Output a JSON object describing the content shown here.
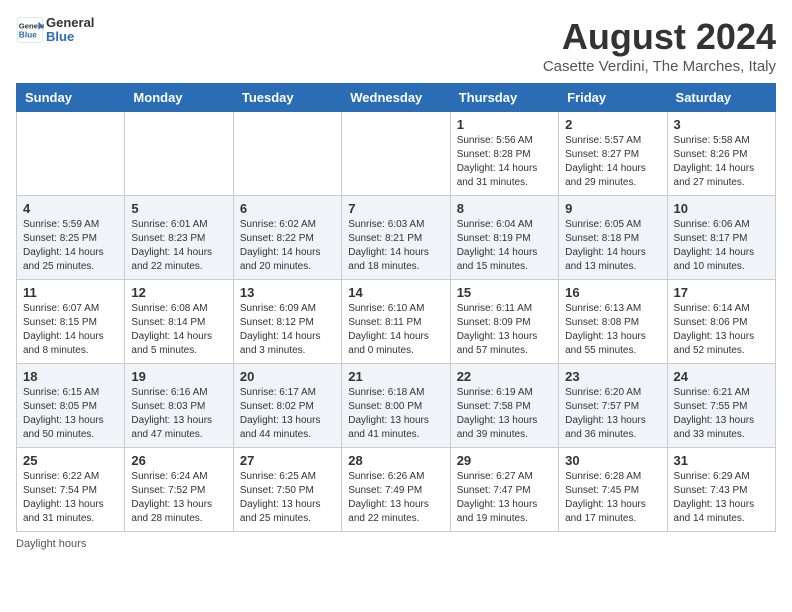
{
  "header": {
    "logo_general": "General",
    "logo_blue": "Blue",
    "month_year": "August 2024",
    "location": "Casette Verdini, The Marches, Italy"
  },
  "days_of_week": [
    "Sunday",
    "Monday",
    "Tuesday",
    "Wednesday",
    "Thursday",
    "Friday",
    "Saturday"
  ],
  "weeks": [
    [
      {
        "day": "",
        "info": ""
      },
      {
        "day": "",
        "info": ""
      },
      {
        "day": "",
        "info": ""
      },
      {
        "day": "",
        "info": ""
      },
      {
        "day": "1",
        "info": "Sunrise: 5:56 AM\nSunset: 8:28 PM\nDaylight: 14 hours\nand 31 minutes."
      },
      {
        "day": "2",
        "info": "Sunrise: 5:57 AM\nSunset: 8:27 PM\nDaylight: 14 hours\nand 29 minutes."
      },
      {
        "day": "3",
        "info": "Sunrise: 5:58 AM\nSunset: 8:26 PM\nDaylight: 14 hours\nand 27 minutes."
      }
    ],
    [
      {
        "day": "4",
        "info": "Sunrise: 5:59 AM\nSunset: 8:25 PM\nDaylight: 14 hours\nand 25 minutes."
      },
      {
        "day": "5",
        "info": "Sunrise: 6:01 AM\nSunset: 8:23 PM\nDaylight: 14 hours\nand 22 minutes."
      },
      {
        "day": "6",
        "info": "Sunrise: 6:02 AM\nSunset: 8:22 PM\nDaylight: 14 hours\nand 20 minutes."
      },
      {
        "day": "7",
        "info": "Sunrise: 6:03 AM\nSunset: 8:21 PM\nDaylight: 14 hours\nand 18 minutes."
      },
      {
        "day": "8",
        "info": "Sunrise: 6:04 AM\nSunset: 8:19 PM\nDaylight: 14 hours\nand 15 minutes."
      },
      {
        "day": "9",
        "info": "Sunrise: 6:05 AM\nSunset: 8:18 PM\nDaylight: 14 hours\nand 13 minutes."
      },
      {
        "day": "10",
        "info": "Sunrise: 6:06 AM\nSunset: 8:17 PM\nDaylight: 14 hours\nand 10 minutes."
      }
    ],
    [
      {
        "day": "11",
        "info": "Sunrise: 6:07 AM\nSunset: 8:15 PM\nDaylight: 14 hours\nand 8 minutes."
      },
      {
        "day": "12",
        "info": "Sunrise: 6:08 AM\nSunset: 8:14 PM\nDaylight: 14 hours\nand 5 minutes."
      },
      {
        "day": "13",
        "info": "Sunrise: 6:09 AM\nSunset: 8:12 PM\nDaylight: 14 hours\nand 3 minutes."
      },
      {
        "day": "14",
        "info": "Sunrise: 6:10 AM\nSunset: 8:11 PM\nDaylight: 14 hours\nand 0 minutes."
      },
      {
        "day": "15",
        "info": "Sunrise: 6:11 AM\nSunset: 8:09 PM\nDaylight: 13 hours\nand 57 minutes."
      },
      {
        "day": "16",
        "info": "Sunrise: 6:13 AM\nSunset: 8:08 PM\nDaylight: 13 hours\nand 55 minutes."
      },
      {
        "day": "17",
        "info": "Sunrise: 6:14 AM\nSunset: 8:06 PM\nDaylight: 13 hours\nand 52 minutes."
      }
    ],
    [
      {
        "day": "18",
        "info": "Sunrise: 6:15 AM\nSunset: 8:05 PM\nDaylight: 13 hours\nand 50 minutes."
      },
      {
        "day": "19",
        "info": "Sunrise: 6:16 AM\nSunset: 8:03 PM\nDaylight: 13 hours\nand 47 minutes."
      },
      {
        "day": "20",
        "info": "Sunrise: 6:17 AM\nSunset: 8:02 PM\nDaylight: 13 hours\nand 44 minutes."
      },
      {
        "day": "21",
        "info": "Sunrise: 6:18 AM\nSunset: 8:00 PM\nDaylight: 13 hours\nand 41 minutes."
      },
      {
        "day": "22",
        "info": "Sunrise: 6:19 AM\nSunset: 7:58 PM\nDaylight: 13 hours\nand 39 minutes."
      },
      {
        "day": "23",
        "info": "Sunrise: 6:20 AM\nSunset: 7:57 PM\nDaylight: 13 hours\nand 36 minutes."
      },
      {
        "day": "24",
        "info": "Sunrise: 6:21 AM\nSunset: 7:55 PM\nDaylight: 13 hours\nand 33 minutes."
      }
    ],
    [
      {
        "day": "25",
        "info": "Sunrise: 6:22 AM\nSunset: 7:54 PM\nDaylight: 13 hours\nand 31 minutes."
      },
      {
        "day": "26",
        "info": "Sunrise: 6:24 AM\nSunset: 7:52 PM\nDaylight: 13 hours\nand 28 minutes."
      },
      {
        "day": "27",
        "info": "Sunrise: 6:25 AM\nSunset: 7:50 PM\nDaylight: 13 hours\nand 25 minutes."
      },
      {
        "day": "28",
        "info": "Sunrise: 6:26 AM\nSunset: 7:49 PM\nDaylight: 13 hours\nand 22 minutes."
      },
      {
        "day": "29",
        "info": "Sunrise: 6:27 AM\nSunset: 7:47 PM\nDaylight: 13 hours\nand 19 minutes."
      },
      {
        "day": "30",
        "info": "Sunrise: 6:28 AM\nSunset: 7:45 PM\nDaylight: 13 hours\nand 17 minutes."
      },
      {
        "day": "31",
        "info": "Sunrise: 6:29 AM\nSunset: 7:43 PM\nDaylight: 13 hours\nand 14 minutes."
      }
    ]
  ],
  "footer": {
    "note": "Daylight hours"
  },
  "colors": {
    "header_bg": "#2a6db5",
    "accent": "#2a6db5"
  }
}
